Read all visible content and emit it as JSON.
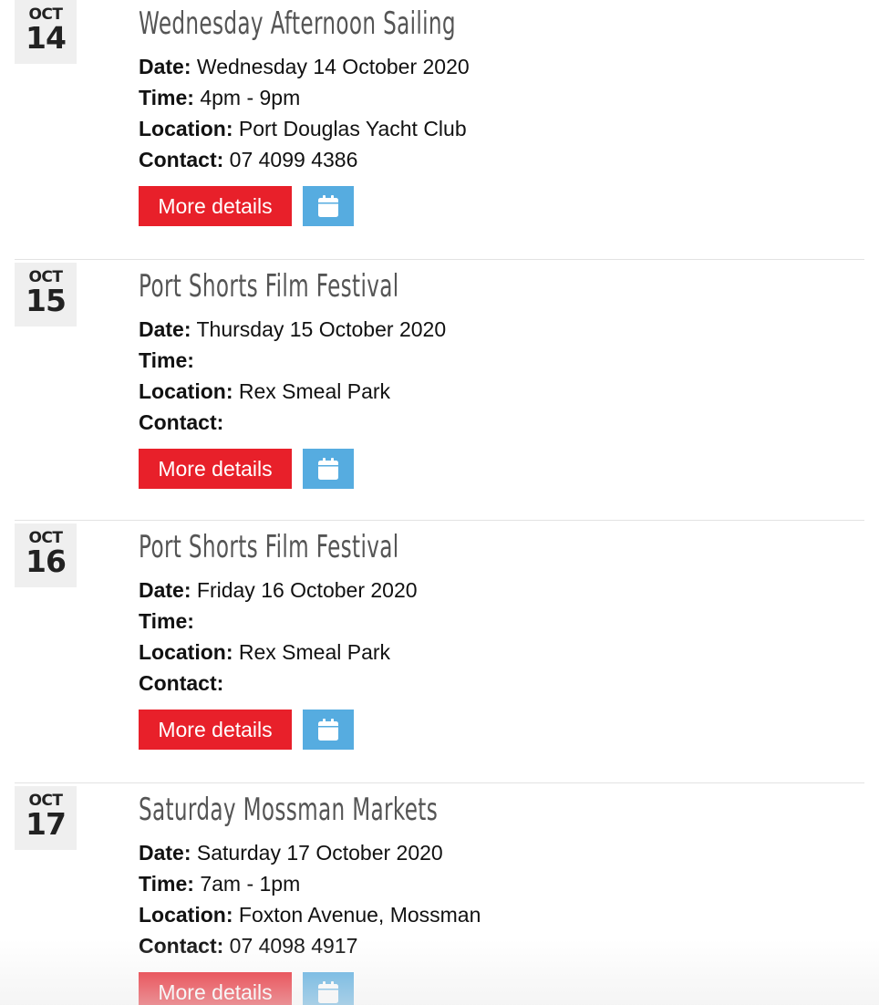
{
  "labels": {
    "date": "Date:",
    "time": "Time:",
    "location": "Location:",
    "contact": "Contact:",
    "more_details": "More details"
  },
  "icons": {
    "calendar": "calendar-icon"
  },
  "colors": {
    "more_button": "#e8202a",
    "calendar_button": "#56ace0",
    "title": "#555555"
  },
  "events": [
    {
      "month": "OCT",
      "day": "14",
      "title": "Wednesday Afternoon Sailing",
      "date": "Wednesday 14 October 2020",
      "time": "4pm - 9pm",
      "location": "Port Douglas Yacht Club",
      "contact": "07 4099 4386"
    },
    {
      "month": "OCT",
      "day": "15",
      "title": "Port Shorts Film Festival",
      "date": "Thursday 15 October 2020",
      "time": "",
      "location": "Rex Smeal Park",
      "contact": ""
    },
    {
      "month": "OCT",
      "day": "16",
      "title": "Port Shorts Film Festival",
      "date": "Friday 16 October 2020",
      "time": "",
      "location": "Rex Smeal Park",
      "contact": ""
    },
    {
      "month": "OCT",
      "day": "17",
      "title": "Saturday Mossman Markets",
      "date": "Saturday 17 October 2020",
      "time": "7am - 1pm",
      "location": "Foxton Avenue, Mossman",
      "contact": "07 4098 4917"
    }
  ]
}
